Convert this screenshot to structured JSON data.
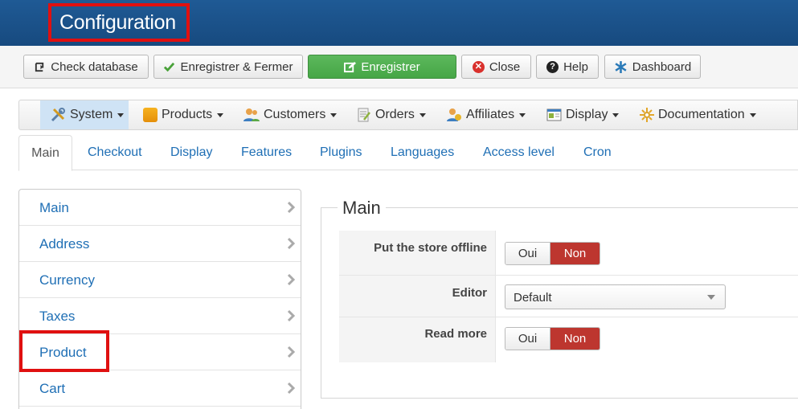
{
  "header": {
    "title": "Configuration"
  },
  "toolbar": {
    "check_database": "Check database",
    "save_close": "Enregistrer & Fermer",
    "save": "Enregistrer",
    "close": "Close",
    "help": "Help",
    "dashboard": "Dashboard"
  },
  "menu": {
    "items": [
      {
        "label": "System",
        "icon": "wrench-screwdriver-icon",
        "active": true
      },
      {
        "label": "Products",
        "icon": "products-box-icon"
      },
      {
        "label": "Customers",
        "icon": "users-icon"
      },
      {
        "label": "Orders",
        "icon": "orders-icon"
      },
      {
        "label": "Affiliates",
        "icon": "affiliates-icon"
      },
      {
        "label": "Display",
        "icon": "display-icon"
      },
      {
        "label": "Documentation",
        "icon": "documentation-icon"
      }
    ]
  },
  "tabs": [
    "Main",
    "Checkout",
    "Display",
    "Features",
    "Plugins",
    "Languages",
    "Access level",
    "Cron"
  ],
  "sidebar": {
    "items": [
      "Main",
      "Address",
      "Currency",
      "Taxes",
      "Product",
      "Cart"
    ]
  },
  "main": {
    "legend": "Main",
    "fields": [
      {
        "label": "Put the store offline",
        "type": "toggle",
        "options": [
          "Oui",
          "Non"
        ],
        "selected": "Non"
      },
      {
        "label": "Editor",
        "type": "select",
        "value": "Default"
      },
      {
        "label": "Read more",
        "type": "toggle",
        "options": [
          "Oui",
          "Non"
        ],
        "selected": "Non"
      }
    ]
  },
  "colors": {
    "header": "#1f5a95",
    "accent": "#1f6fb5",
    "save_green": "#5cb85c",
    "toggle_selected": "#bd362f",
    "highlight": "#e01010"
  }
}
